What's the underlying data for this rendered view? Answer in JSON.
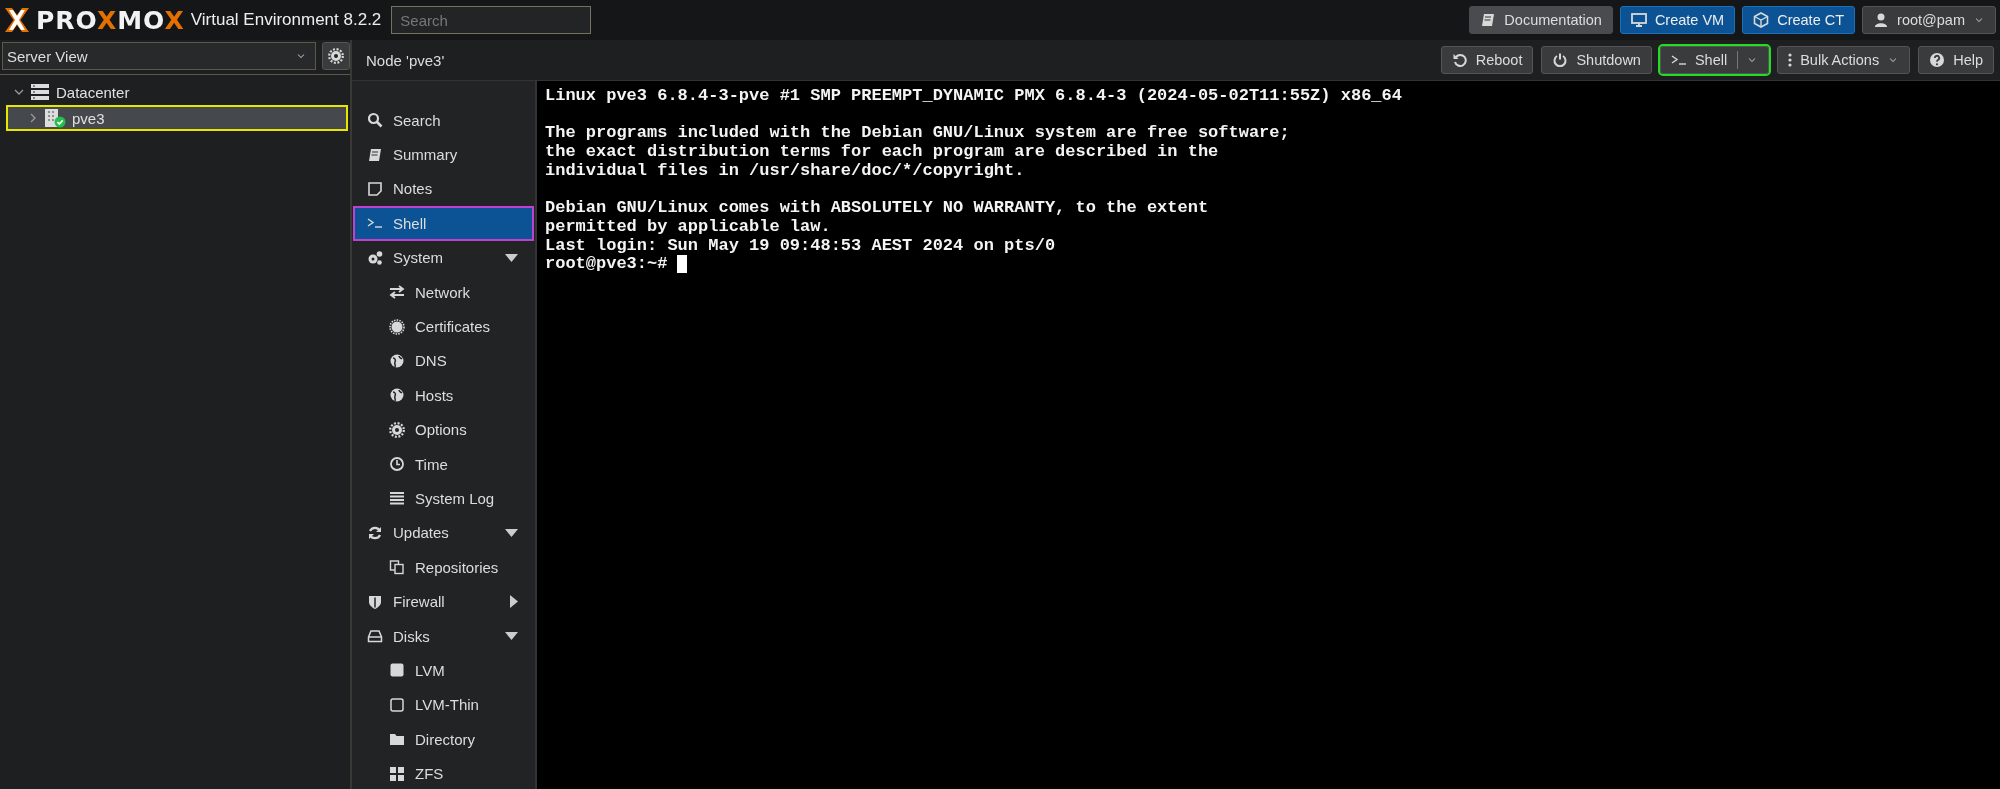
{
  "header": {
    "logo": [
      {
        "text": "PRO",
        "accent": false
      },
      {
        "text": "X",
        "accent": true
      },
      {
        "text": "MO",
        "accent": false
      },
      {
        "text": "X",
        "accent": true
      }
    ],
    "product": "Virtual Environment 8.2.2",
    "search": {
      "placeholder": "Search"
    },
    "buttons": [
      {
        "label": "Documentation",
        "kind": "default"
      },
      {
        "label": "Create VM",
        "kind": "primary"
      },
      {
        "label": "Create CT",
        "kind": "primary"
      },
      {
        "label": "root@pam",
        "kind": "menu"
      }
    ]
  },
  "sidebar": {
    "view": {
      "value": "Server View"
    },
    "tree": [
      {
        "label": "Datacenter",
        "expanded": true,
        "selected": false,
        "children": [
          {
            "label": "pve3",
            "expanded": false,
            "selected": true,
            "online": true
          }
        ]
      }
    ]
  },
  "toolbar": {
    "title": "Node 'pve3'",
    "buttons": [
      {
        "label": "Reboot",
        "kind": "default",
        "focused": false
      },
      {
        "label": "Shutdown",
        "kind": "default",
        "focused": false
      },
      {
        "label": "Shell",
        "kind": "split",
        "focused": true
      },
      {
        "label": "Bulk Actions",
        "kind": "menu",
        "focused": false
      },
      {
        "label": "Help",
        "kind": "help",
        "focused": false
      }
    ]
  },
  "nav": [
    {
      "label": "Search",
      "selected": false
    },
    {
      "label": "Summary",
      "selected": false
    },
    {
      "label": "Notes",
      "selected": false
    },
    {
      "label": "Shell",
      "selected": true
    },
    {
      "label": "System",
      "selected": false,
      "expanded": true,
      "children": [
        {
          "label": "Network",
          "selected": false
        },
        {
          "label": "Certificates",
          "selected": false
        },
        {
          "label": "DNS",
          "selected": false
        },
        {
          "label": "Hosts",
          "selected": false
        },
        {
          "label": "Options",
          "selected": false
        },
        {
          "label": "Time",
          "selected": false
        },
        {
          "label": "System Log",
          "selected": false
        }
      ]
    },
    {
      "label": "Updates",
      "selected": false,
      "expanded": true,
      "children": [
        {
          "label": "Repositories",
          "selected": false
        }
      ]
    },
    {
      "label": "Firewall",
      "selected": false,
      "expanded": false
    },
    {
      "label": "Disks",
      "selected": false,
      "expanded": true,
      "children": [
        {
          "label": "LVM",
          "selected": false
        },
        {
          "label": "LVM-Thin",
          "selected": false
        },
        {
          "label": "Directory",
          "selected": false
        },
        {
          "label": "ZFS",
          "selected": false
        }
      ]
    }
  ],
  "terminal": {
    "blocks": [
      [
        "Linux pve3 6.8.4-3-pve #1 SMP PREEMPT_DYNAMIC PMX 6.8.4-3 (2024-05-02T11:55Z) x86_64"
      ],
      [
        "The programs included with the Debian GNU/Linux system are free software;",
        "the exact distribution terms for each program are described in the",
        "individual files in /usr/share/doc/*/copyright."
      ],
      [
        "Debian GNU/Linux comes with ABSOLUTELY NO WARRANTY, to the extent",
        "permitted by applicable law.",
        "Last login: Sun May 19 09:48:53 AEST 2024 on pts/0",
        "root@pve3:~#"
      ]
    ],
    "cursor": true
  }
}
